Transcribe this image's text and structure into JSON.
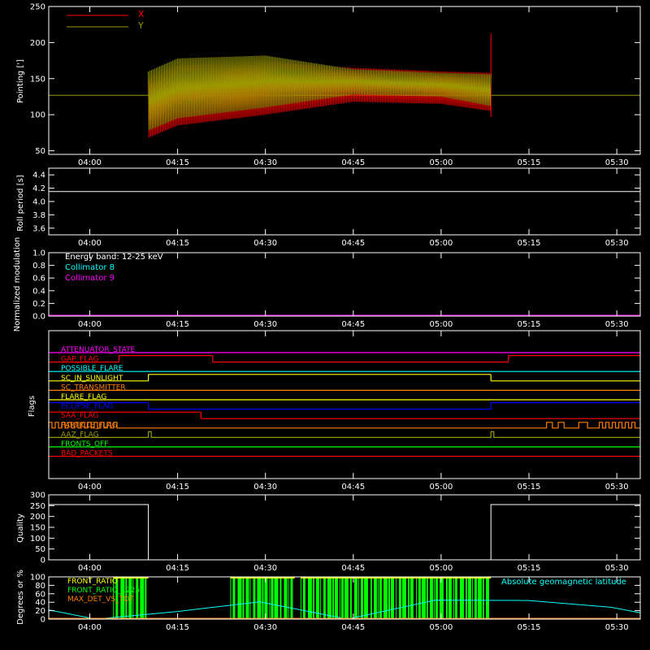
{
  "colors": {
    "background": "#000000",
    "axis": "#ffffff",
    "x": "#ff0000",
    "y": "#9a9a00",
    "cyan": "#00ffff",
    "magenta": "#ff00ff",
    "green": "#00ff00",
    "yellow": "#ffff00",
    "orange": "#ff8000",
    "blue": "#0000ff",
    "olive": "#9a9a00",
    "red": "#ff0000"
  },
  "chart_data": [
    {
      "id": "pointing",
      "type": "line",
      "ylabel": "Pointing [']",
      "ylim": [
        45,
        250
      ],
      "yticks": [
        50,
        100,
        150,
        200,
        250
      ],
      "xlim": [
        3.8833,
        5.5667
      ],
      "x_ticks": [
        "04:00",
        "04:15",
        "04:30",
        "04:45",
        "05:00",
        "05:15",
        "05:30"
      ],
      "legend": [
        {
          "label": "X",
          "color": "#ff0000"
        },
        {
          "label": "Y",
          "color": "#9a9a00"
        }
      ],
      "reference_line": 127,
      "series": [
        {
          "name": "X",
          "x": [
            4.1667,
            4.25,
            4.5,
            4.75,
            5.0,
            5.1417
          ],
          "upper": [
            150,
            168,
            173,
            165,
            160,
            158
          ],
          "lower": [
            68,
            85,
            100,
            118,
            115,
            105
          ],
          "end_spike": 212
        },
        {
          "name": "Y",
          "x": [
            4.1667,
            4.25,
            4.5,
            4.75,
            5.0,
            5.1417
          ],
          "upper": [
            160,
            178,
            182,
            163,
            158,
            156
          ],
          "lower": [
            78,
            95,
            110,
            128,
            125,
            112
          ]
        }
      ]
    },
    {
      "id": "roll",
      "type": "line",
      "ylabel": "Roll period [s]",
      "ylim": [
        3.5,
        4.5
      ],
      "yticks": [
        3.6,
        3.8,
        4.0,
        4.2,
        4.4
      ],
      "x_ticks": [
        "04:00",
        "04:15",
        "04:30",
        "04:45",
        "05:00",
        "05:15",
        "05:30"
      ],
      "series": [
        {
          "x": [
            3.8833,
            5.5667
          ],
          "y": [
            4.15,
            4.15
          ]
        }
      ]
    },
    {
      "id": "modulation",
      "type": "line",
      "ylabel": "Normalized modulation",
      "ylim": [
        0,
        1
      ],
      "yticks": [
        0.0,
        0.2,
        0.4,
        0.6,
        0.8,
        1.0
      ],
      "x_ticks": [
        "04:00",
        "04:15",
        "04:30",
        "04:45",
        "05:00",
        "05:15",
        "05:30"
      ],
      "annotations": [
        "Energy band: 12-25 keV",
        "Collimator 8",
        "Collimator 9"
      ],
      "series": [
        {
          "name": "Collimator 9",
          "x": [
            3.8833,
            5.5667
          ],
          "y": [
            0,
            0
          ]
        }
      ]
    },
    {
      "id": "flags",
      "type": "line",
      "ylabel": "Flags",
      "x_ticks": [
        "04:00",
        "04:15",
        "04:30",
        "04:45",
        "05:00",
        "05:15",
        "05:30"
      ],
      "flags": [
        {
          "label": "ATTENUATOR_STATE",
          "color": "#ff00ff",
          "segments": [
            [
              3.8833,
              5.5667,
              0
            ]
          ]
        },
        {
          "label": "GAP_FLAG",
          "color": "#ff0000",
          "segments": [
            [
              3.8833,
              4.0833,
              0
            ],
            [
              4.0833,
              4.1833,
              1
            ],
            [
              4.1833,
              4.35,
              1
            ],
            [
              4.35,
              5.1917,
              0
            ],
            [
              5.1917,
              5.5667,
              1
            ]
          ]
        },
        {
          "label": "POSSIBLE_FLARE",
          "color": "#00ffff",
          "segments": [
            [
              3.8833,
              5.5667,
              0
            ]
          ]
        },
        {
          "label": "SC_IN_SUNLIGHT",
          "color": "#ffff00",
          "segments": [
            [
              3.8833,
              4.1667,
              0
            ],
            [
              4.1667,
              5.1417,
              1
            ],
            [
              5.1417,
              5.5667,
              0
            ]
          ]
        },
        {
          "label": "SC_TRANSMITTER",
          "color": "#ff8000",
          "segments": [
            [
              3.8833,
              5.5667,
              0
            ]
          ]
        },
        {
          "label": "FLARE_FLAG",
          "color": "#ffff00",
          "segments": [
            [
              3.8833,
              5.5667,
              0
            ]
          ]
        },
        {
          "label": "ECLIPSE_FLAG",
          "color": "#0000ff",
          "segments": [
            [
              3.8833,
              4.1667,
              1
            ],
            [
              4.1667,
              5.1417,
              0
            ],
            [
              5.1417,
              5.5667,
              1
            ]
          ]
        },
        {
          "label": "SAA_FLAG",
          "color": "#ff0000",
          "segments": [
            [
              3.8833,
              4.3167,
              1
            ],
            [
              4.3167,
              5.5667,
              0
            ]
          ]
        },
        {
          "label": "PARTICLE_FLAG",
          "color": "#ff8000",
          "pulses": [
            [
              3.8833,
              4.1
            ],
            [
              5.3,
              5.3167
            ],
            [
              5.3333,
              5.35
            ],
            [
              5.3917,
              5.4167
            ],
            [
              5.45,
              5.5667
            ]
          ]
        },
        {
          "label": "AAZ_FLAG",
          "color": "#9a9a00",
          "pulses": [
            [
              4.1667,
              4.175
            ],
            [
              5.1417,
              5.15
            ]
          ]
        },
        {
          "label": "FRONTS_OFF",
          "color": "#00ff00",
          "segments": [
            [
              3.8833,
              5.5667,
              0
            ]
          ]
        },
        {
          "label": "BAD_PACKETS",
          "color": "#ff0000",
          "segments": [
            [
              3.8833,
              5.5667,
              0
            ]
          ]
        }
      ]
    },
    {
      "id": "quality",
      "type": "line",
      "ylabel": "Quality",
      "ylim": [
        0,
        300
      ],
      "yticks": [
        0,
        50,
        100,
        150,
        200,
        250,
        300
      ],
      "x_ticks": [
        "04:00",
        "04:15",
        "04:30",
        "04:45",
        "05:00",
        "05:15",
        "05:30"
      ],
      "series": [
        {
          "x": [
            3.8833,
            4.1667,
            4.1667,
            5.1417,
            5.1417,
            5.5667
          ],
          "y": [
            255,
            255,
            0,
            0,
            255,
            255
          ]
        }
      ]
    },
    {
      "id": "ratios",
      "type": "line",
      "ylabel": "Degrees or %",
      "ylim": [
        0,
        100
      ],
      "yticks": [
        0,
        20,
        40,
        60,
        80,
        100
      ],
      "x_ticks": [
        "04:00",
        "04:15",
        "04:30",
        "04:45",
        "05:00",
        "05:15",
        "05:30"
      ],
      "legend": [
        {
          "label": "FRONT_RATIO",
          "color": "#ffff00"
        },
        {
          "label": "FRONT_RATIO_1225",
          "color": "#00ff00"
        },
        {
          "label": "MAX_DET_VS_TOT",
          "color": "#ff8000"
        }
      ],
      "annotation": "Absolute geomagnetic latitude",
      "latitude": {
        "x": [
          3.8833,
          4.0167,
          4.25,
          4.4833,
          4.7333,
          4.9833,
          5.25,
          5.4833,
          5.5667
        ],
        "y": [
          22,
          0,
          18,
          41,
          0,
          45,
          44,
          28,
          15
        ]
      },
      "green_regions": [
        [
          4.0667,
          4.1667
        ],
        [
          4.4,
          4.5833
        ],
        [
          4.6,
          5.1417
        ]
      ]
    }
  ]
}
